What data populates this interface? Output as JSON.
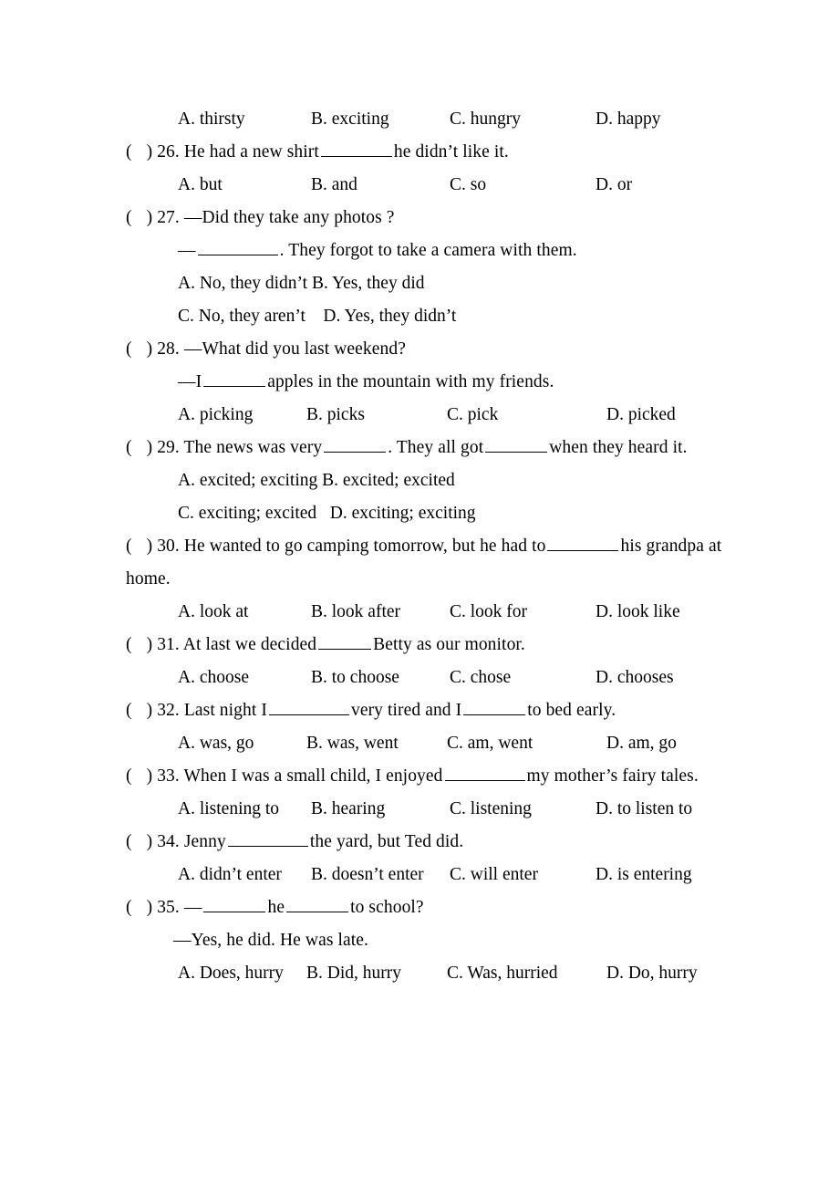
{
  "document": {
    "type": "english-grammar-worksheet",
    "page_background": "#ffffff",
    "text_color": "#000000"
  },
  "top_options_row": {
    "a": "A. thirsty",
    "b": "B. exciting",
    "c": "C. hungry",
    "d": "D. happy"
  },
  "questions": [
    {
      "number": "26.",
      "marker_open": "(",
      "marker_close": ")",
      "stem_before": "He had a new shirt",
      "stem_after": "he didn’t like it.",
      "options": {
        "a": "A. but",
        "b": "B. and",
        "c": "C. so",
        "d": "D. or"
      }
    },
    {
      "number": "27.",
      "marker_open": "(",
      "marker_close": ")",
      "stem": "—Did they take any photos ?",
      "reply_dash": "—",
      "reply_after": ". They forgot to take a camera with them.",
      "options_line1": "A. No, they didn’t B. Yes, they did",
      "options_line2": "C. No, they aren’t    D. Yes, they didn’t"
    },
    {
      "number": "28.",
      "marker_open": "(",
      "marker_close": ")",
      "stem": "—What did you last weekend?",
      "reply_before": "—I",
      "reply_after": "apples in the mountain with my friends.",
      "options": {
        "a": "A. picking",
        "b": "B. picks",
        "c": "C. pick",
        "d": "D. picked"
      }
    },
    {
      "number": "29.",
      "marker_open": "(",
      "marker_close": ")",
      "stem_before": "The news was very",
      "stem_middle": ". They all got",
      "stem_after": "when they heard it.",
      "options_line1": "A. excited; exciting B. excited; excited",
      "options_line2": "C. exciting; excited   D. exciting; exciting"
    },
    {
      "number": "30.",
      "marker_open": "(",
      "marker_close": ")",
      "stem_before": "He wanted to go camping tomorrow, but he had to",
      "stem_after": "his grandpa at home.",
      "options": {
        "a": "A. look at",
        "b": "B. look after",
        "c": "C. look for",
        "d": "D. look like"
      }
    },
    {
      "number": "31.",
      "marker_open": "(",
      "marker_close": ")",
      "stem_before": "At last we decided",
      "stem_after": "Betty as our monitor.",
      "options": {
        "a": "A. choose",
        "b": "B. to choose",
        "c": "C. chose",
        "d": "D. chooses"
      }
    },
    {
      "number": "32.",
      "marker_open": "(",
      "marker_close": ")",
      "stem_before": "Last night I",
      "stem_middle": "very tired and I",
      "stem_after": "to bed early.",
      "options": {
        "a": "A. was, go",
        "b": "B. was, went",
        "c": "C. am, went",
        "d": "D. am, go"
      }
    },
    {
      "number": "33.",
      "marker_open": "(",
      "marker_close": ")",
      "stem_before": "When I was a small child, I enjoyed",
      "stem_after": "my mother’s fairy tales.",
      "options": {
        "a": "A. listening to",
        "b": "B. hearing",
        "c": "C. listening",
        "d": "D. to listen to"
      }
    },
    {
      "number": "34.",
      "marker_open": "(",
      "marker_close": ")",
      "stem_before": "Jenny",
      "stem_after": "the yard, but Ted did.",
      "options": {
        "a": "A. didn’t enter",
        "b": "B. doesn’t enter",
        "c": "C. will enter",
        "d": "D. is entering"
      }
    },
    {
      "number": "35.",
      "marker_open": "(",
      "marker_close": ")",
      "stem_dash": "—",
      "stem_middle": "he",
      "stem_after": "to school?",
      "reply": "—Yes, he did. He was late.",
      "options": {
        "a": "A. Does, hurry",
        "b": "B. Did, hurry",
        "c": "C. Was, hurried",
        "d": "D. Do, hurry"
      }
    }
  ]
}
